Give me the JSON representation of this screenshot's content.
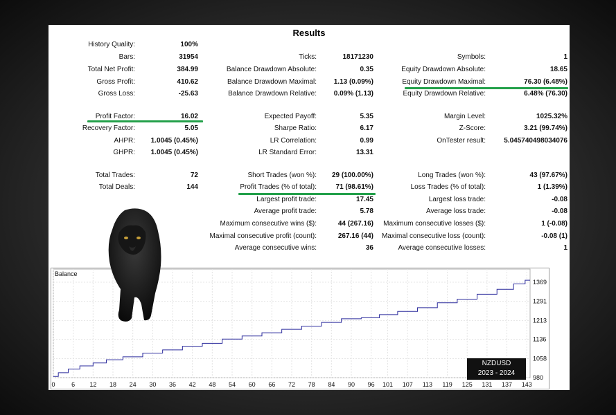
{
  "title": "Results",
  "col1": [
    {
      "label": "History Quality:",
      "value": "100%"
    },
    {
      "label": "Bars:",
      "value": "31954"
    },
    {
      "label": "Total Net Profit:",
      "value": "384.99"
    },
    {
      "label": "Gross Profit:",
      "value": "410.62"
    },
    {
      "label": "Gross Loss:",
      "value": "-25.63"
    },
    {
      "label": "Profit Factor:",
      "value": "16.02"
    },
    {
      "label": "Recovery Factor:",
      "value": "5.05"
    },
    {
      "label": "AHPR:",
      "value": "1.0045 (0.45%)"
    },
    {
      "label": "GHPR:",
      "value": "1.0045 (0.45%)"
    },
    {
      "label": "Total Trades:",
      "value": "72"
    },
    {
      "label": "Total Deals:",
      "value": "144"
    }
  ],
  "col2": [
    {
      "label": "Ticks:",
      "value": "18171230"
    },
    {
      "label": "Balance Drawdown Absolute:",
      "value": "0.35"
    },
    {
      "label": "Balance Drawdown Maximal:",
      "value": "1.13 (0.09%)"
    },
    {
      "label": "Balance Drawdown Relative:",
      "value": "0.09% (1.13)"
    },
    {
      "label": "Expected Payoff:",
      "value": "5.35"
    },
    {
      "label": "Sharpe Ratio:",
      "value": "6.17"
    },
    {
      "label": "LR Correlation:",
      "value": "0.99"
    },
    {
      "label": "LR Standard Error:",
      "value": "13.31"
    },
    {
      "label": "Short Trades (won %):",
      "value": "29 (100.00%)"
    },
    {
      "label": "Profit Trades (% of total):",
      "value": "71 (98.61%)"
    },
    {
      "label": "Largest profit trade:",
      "value": "17.45"
    },
    {
      "label": "Average profit trade:",
      "value": "5.78"
    },
    {
      "label": "Maximum consecutive wins ($):",
      "value": "44 (267.16)"
    },
    {
      "label": "Maximal consecutive profit (count):",
      "value": "267.16 (44)"
    },
    {
      "label": "Average consecutive wins:",
      "value": "36"
    }
  ],
  "col3": [
    {
      "label": "Symbols:",
      "value": "1"
    },
    {
      "label": "Equity Drawdown Absolute:",
      "value": "18.65"
    },
    {
      "label": "Equity Drawdown Maximal:",
      "value": "76.30 (6.48%)"
    },
    {
      "label": "Equity Drawdown Relative:",
      "value": "6.48% (76.30)"
    },
    {
      "label": "Margin Level:",
      "value": "1025.32%"
    },
    {
      "label": "Z-Score:",
      "value": "3.21 (99.74%)"
    },
    {
      "label": "OnTester result:",
      "value": "5.045740498034076"
    },
    {
      "label": "Long Trades (won %):",
      "value": "43 (97.67%)"
    },
    {
      "label": "Loss Trades (% of total):",
      "value": "1 (1.39%)"
    },
    {
      "label": "Largest loss trade:",
      "value": "-0.08"
    },
    {
      "label": "Average loss trade:",
      "value": "-0.08"
    },
    {
      "label": "Maximum consecutive losses ($):",
      "value": "1 (-0.08)"
    },
    {
      "label": "Maximal consecutive loss (count):",
      "value": "-0.08 (1)"
    },
    {
      "label": "Average consecutive losses:",
      "value": "1"
    }
  ],
  "badge": {
    "symbol": "NZDUSD",
    "period": "2023 - 2024"
  },
  "highlight_color": "#23a04a",
  "chart_data": {
    "type": "line",
    "title": "Balance",
    "xlabel": "",
    "ylabel": "",
    "xlim": [
      0,
      144
    ],
    "ylim": [
      980,
      1400
    ],
    "x_ticks": [
      0,
      6,
      12,
      18,
      24,
      30,
      36,
      42,
      48,
      54,
      60,
      66,
      72,
      78,
      84,
      90,
      96,
      101,
      107,
      113,
      119,
      125,
      131,
      137,
      143
    ],
    "y_ticks": [
      980,
      1058,
      1136,
      1213,
      1291,
      1369
    ],
    "line_color": "#2a2a9c",
    "series": [
      {
        "x": [
          0,
          3,
          6,
          10,
          14,
          18,
          24,
          30,
          36,
          42,
          48,
          54,
          60,
          66,
          72,
          78,
          84,
          90,
          96,
          101,
          107,
          113,
          119,
          125,
          131,
          137,
          141,
          144
        ],
        "y": [
          985,
          1000,
          1015,
          1028,
          1040,
          1053,
          1065,
          1080,
          1093,
          1108,
          1120,
          1137,
          1150,
          1163,
          1177,
          1190,
          1205,
          1220,
          1224,
          1237,
          1250,
          1265,
          1285,
          1300,
          1320,
          1340,
          1362,
          1377
        ]
      }
    ]
  }
}
